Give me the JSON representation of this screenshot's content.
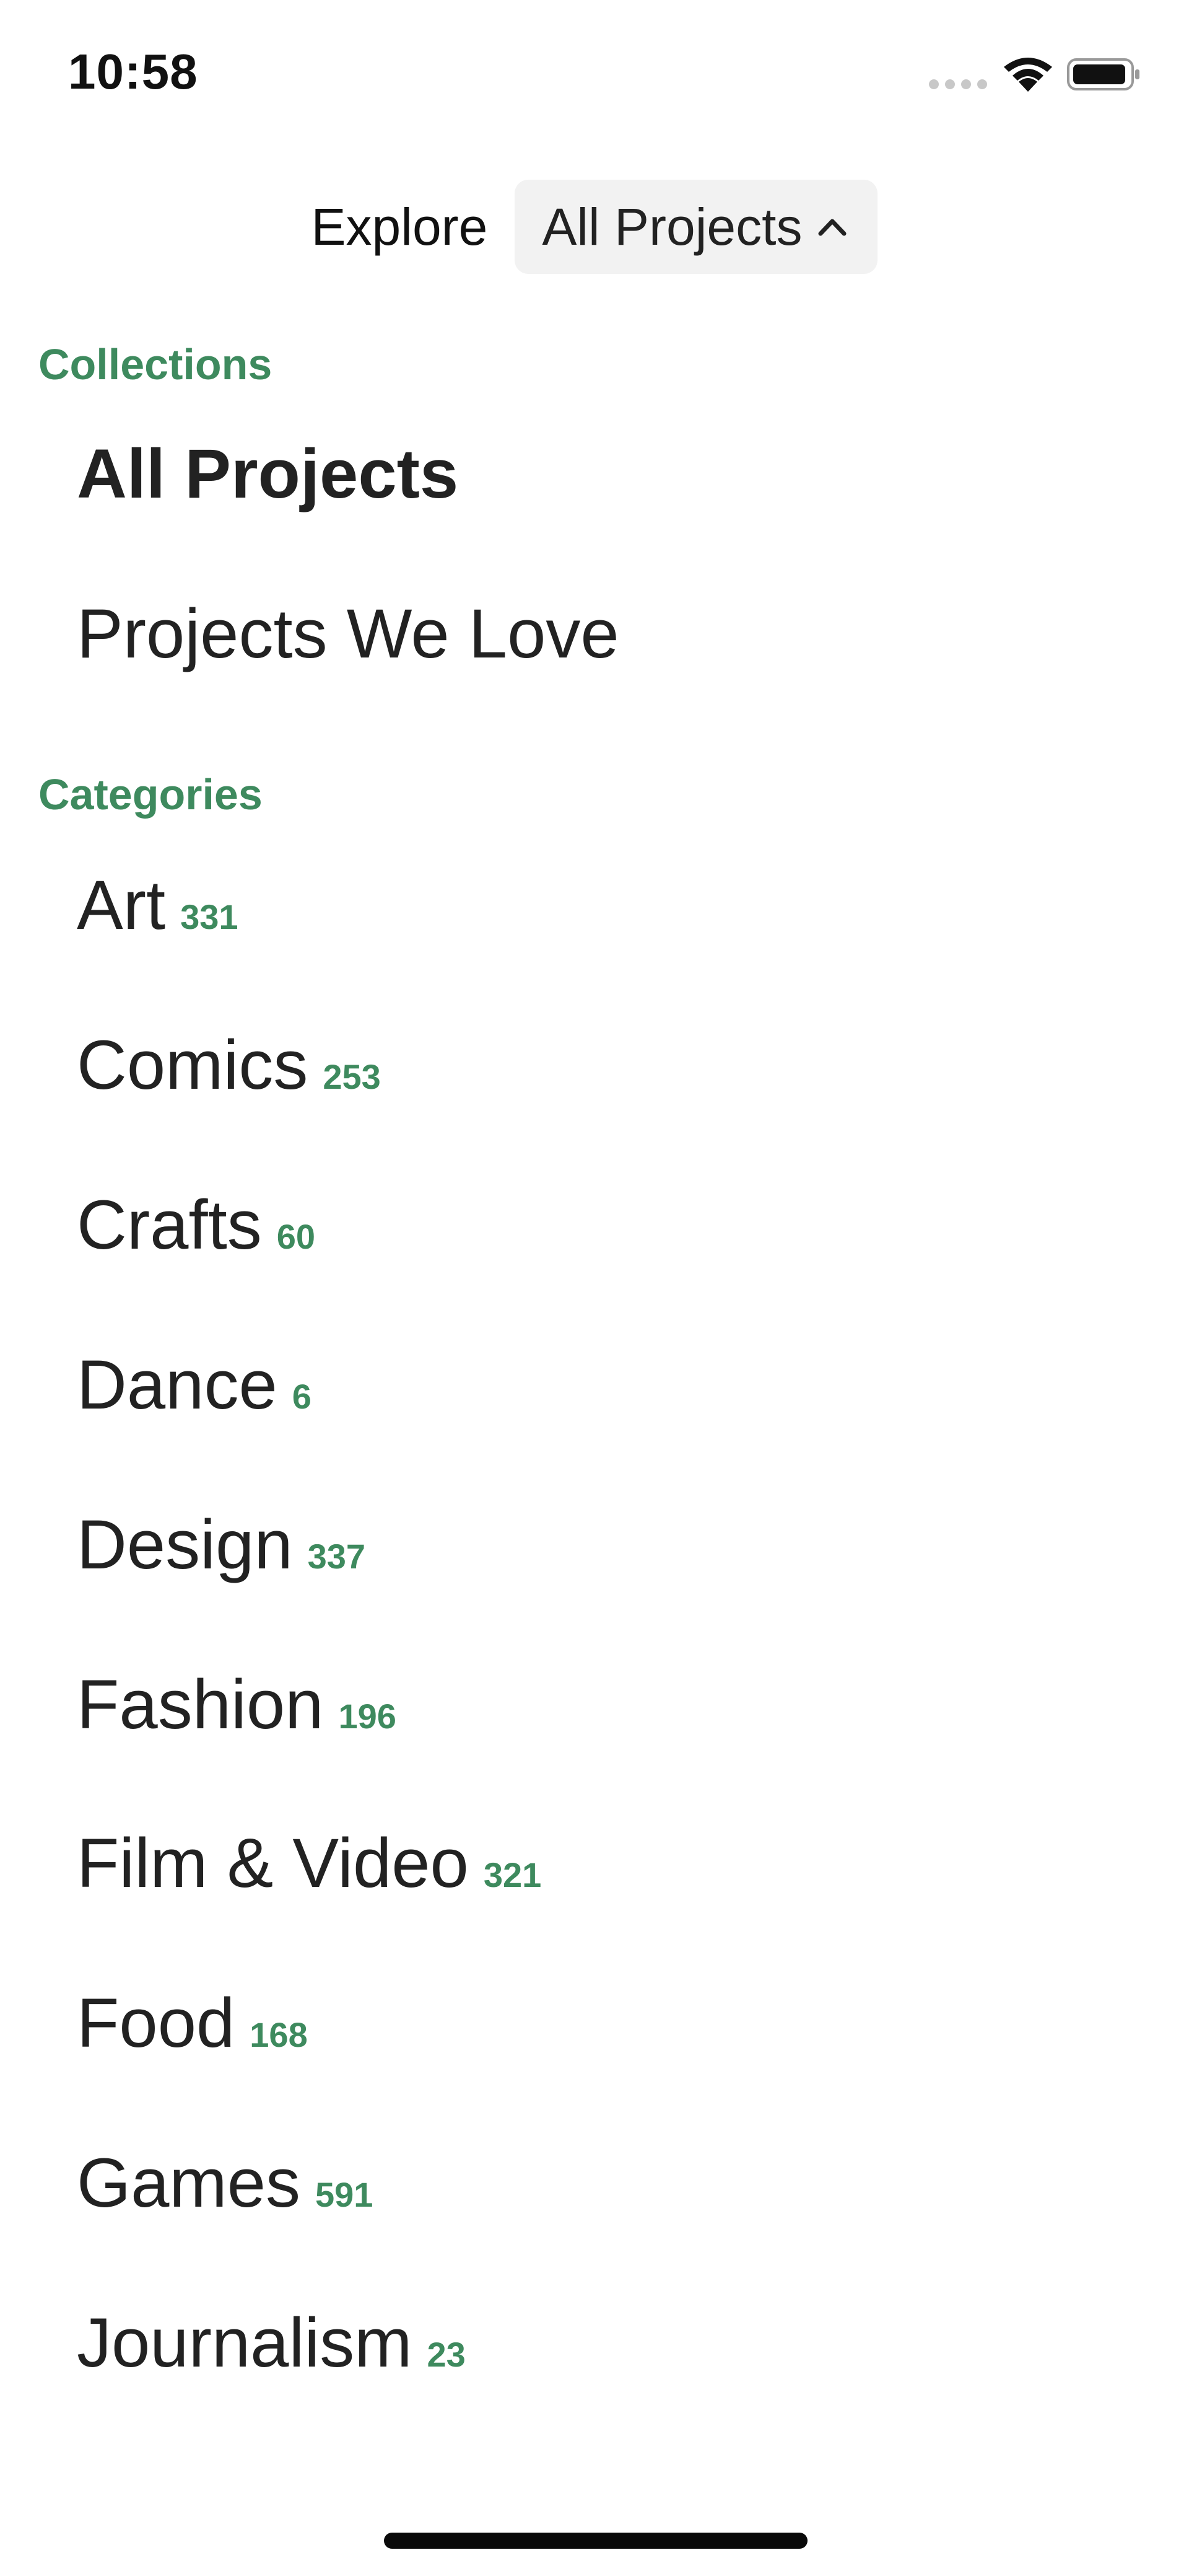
{
  "status_bar": {
    "time": "10:58"
  },
  "header": {
    "explore_label": "Explore",
    "dropdown_label": "All Projects",
    "dropdown_icon": "chevron-up-icon"
  },
  "collections": {
    "title": "Collections",
    "items": [
      {
        "label": "All Projects",
        "selected": true
      },
      {
        "label": "Projects We Love",
        "selected": false
      }
    ]
  },
  "categories": {
    "title": "Categories",
    "items": [
      {
        "label": "Art",
        "count": "331"
      },
      {
        "label": "Comics",
        "count": "253"
      },
      {
        "label": "Crafts",
        "count": "60"
      },
      {
        "label": "Dance",
        "count": "6"
      },
      {
        "label": "Design",
        "count": "337"
      },
      {
        "label": "Fashion",
        "count": "196"
      },
      {
        "label": "Film & Video",
        "count": "321"
      },
      {
        "label": "Food",
        "count": "168"
      },
      {
        "label": "Games",
        "count": "591"
      },
      {
        "label": "Journalism",
        "count": "23"
      }
    ]
  },
  "colors": {
    "accent": "#3e8a5e",
    "text": "#222222",
    "dropdown_bg": "#f2f2f2"
  }
}
